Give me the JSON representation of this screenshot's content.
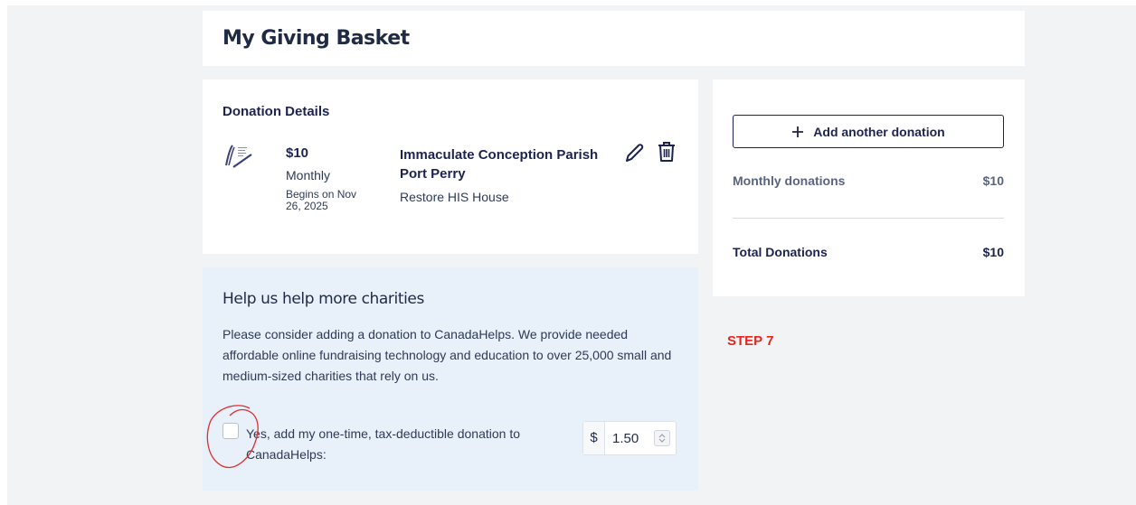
{
  "header": {
    "title": "My Giving Basket"
  },
  "donation_details": {
    "title": "Donation Details",
    "item": {
      "amount": "$10",
      "frequency": "Monthly",
      "begins": "Begins on Nov 26, 2025",
      "charity": "Immaculate Conception Parish Port Perry",
      "fund": "Restore HIS House",
      "edit_icon": "pencil-icon",
      "delete_icon": "trash-icon"
    }
  },
  "help": {
    "title": "Help us help more charities",
    "text": "Please consider adding a donation to CanadaHelps. We provide needed affordable online fundraising technology and education to over 25,000 small and medium-sized charities that rely on us.",
    "checkbox_label": "Yes, add my one-time, tax-deductible donation to CanadaHelps:",
    "checkbox_checked": false,
    "currency": "$",
    "amount_value": "1.50"
  },
  "summary": {
    "add_button_label": "Add another donation",
    "add_icon": "plus-icon",
    "monthly_label": "Monthly donations",
    "monthly_value": "$10",
    "total_label": "Total Donations",
    "total_value": "$10"
  },
  "annotation": {
    "step_label": "STEP 7",
    "color": "#e3261e"
  },
  "colors": {
    "navy": "#1c2350",
    "help_bg": "#e8f0f9",
    "page_bg": "#f2f3f5"
  }
}
